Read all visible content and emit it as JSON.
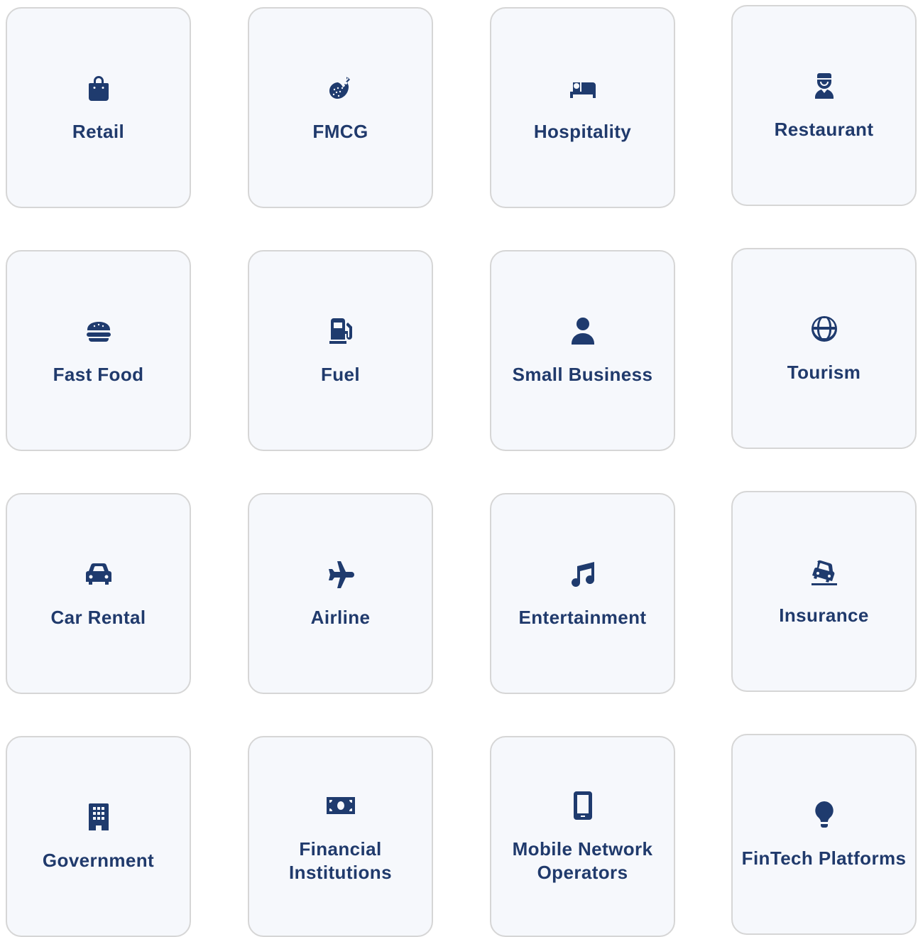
{
  "colors": {
    "accent": "#1f3b6e",
    "card_background": "#f6f8fc",
    "card_border": "#d6d6d6"
  },
  "industries": [
    {
      "label": "Retail",
      "icon": "shopping-bag-icon"
    },
    {
      "label": "FMCG",
      "icon": "strawberry-icon"
    },
    {
      "label": "Hospitality",
      "icon": "bed-icon"
    },
    {
      "label": "Restaurant",
      "icon": "chef-icon"
    },
    {
      "label": "Fast Food",
      "icon": "burger-icon"
    },
    {
      "label": "Fuel",
      "icon": "gas-pump-icon"
    },
    {
      "label": "Small Business",
      "icon": "person-icon"
    },
    {
      "label": "Tourism",
      "icon": "globe-icon"
    },
    {
      "label": "Car Rental",
      "icon": "car-icon"
    },
    {
      "label": "Airline",
      "icon": "airplane-icon"
    },
    {
      "label": "Entertainment",
      "icon": "music-note-icon"
    },
    {
      "label": "Insurance",
      "icon": "car-burst-icon"
    },
    {
      "label": "Government",
      "icon": "building-icon"
    },
    {
      "label": "Financial Institutions",
      "icon": "money-bill-icon"
    },
    {
      "label": "Mobile Network Operators",
      "icon": "mobile-phone-icon"
    },
    {
      "label": "FinTech Platforms",
      "icon": "lightbulb-icon"
    }
  ]
}
